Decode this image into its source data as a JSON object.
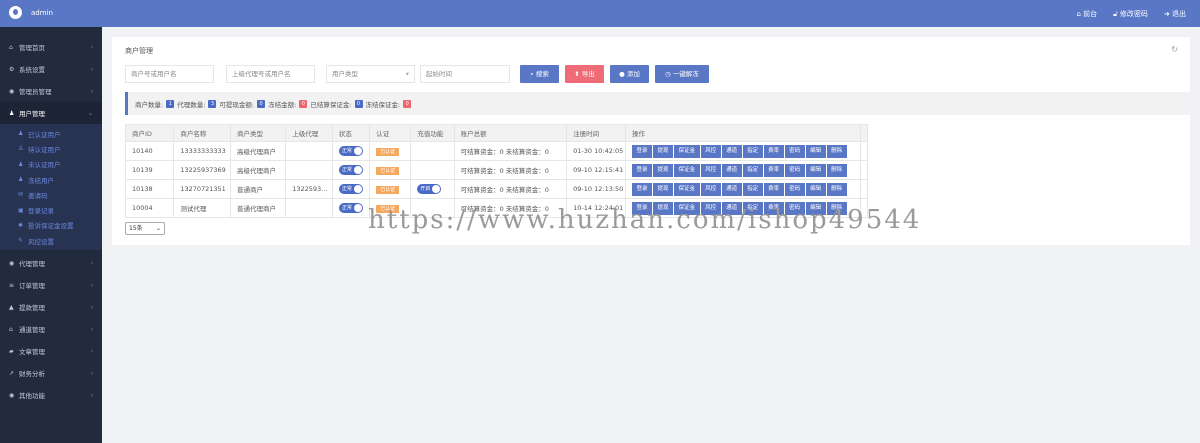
{
  "header": {
    "user": "admin",
    "links": [
      "前台",
      "修改密码",
      "退出"
    ]
  },
  "sidebar": {
    "items": [
      {
        "label": "管理首页",
        "icon": "home-icon"
      },
      {
        "label": "系统设置",
        "icon": "gears-icon"
      },
      {
        "label": "管理员管理",
        "icon": "user-circle-icon"
      },
      {
        "label": "用户管理",
        "icon": "users-icon",
        "open": true
      }
    ],
    "sub": [
      "已认证用户",
      "待认证用户",
      "未认证用户",
      "冻结用户",
      "邀请码",
      "登录记录",
      "投诉保证金设置",
      "风控设置"
    ],
    "items2": [
      {
        "label": "代理管理",
        "icon": "user-circle-icon"
      },
      {
        "label": "订单管理",
        "icon": "list-icon"
      },
      {
        "label": "提款管理",
        "icon": "bank-icon"
      },
      {
        "label": "通道管理",
        "icon": "institution-icon"
      },
      {
        "label": "文章管理",
        "icon": "book-icon"
      },
      {
        "label": "财务分析",
        "icon": "chart-icon"
      },
      {
        "label": "其他功能",
        "icon": "user-circle-icon"
      }
    ]
  },
  "page": {
    "title": "商户管理"
  },
  "filters": {
    "merchant_placeholder": "商户号或用户名",
    "agent_placeholder": "上级代理号或用户名",
    "type_select": "用户类型",
    "time_placeholder": "起始时间"
  },
  "buttons": {
    "search": "搜索",
    "export": "导出",
    "add": "添加",
    "unfreeze": "一键解冻"
  },
  "stats": [
    {
      "label": "商户数量:",
      "value": "1",
      "color": "#4a6bc5"
    },
    {
      "label": "代理数量:",
      "value": "3",
      "color": "#4a6bc5"
    },
    {
      "label": "可提现金额:",
      "value": "0",
      "color": "#4a6bc5"
    },
    {
      "label": "冻结金额:",
      "value": "0",
      "color": "#f0646e"
    },
    {
      "label": "已结算保证金:",
      "value": "0",
      "color": "#4a6bc5"
    },
    {
      "label": "冻结保证金:",
      "value": "0",
      "color": "#f0646e"
    }
  ],
  "table": {
    "headers": [
      "商户ID",
      "商户名称",
      "商户类型",
      "上级代理",
      "状态",
      "认证",
      "充值功能",
      "账户总额",
      "注册时间",
      "操作"
    ],
    "rows": [
      {
        "id": "10140",
        "name": "13333333333",
        "type": "高级代理商户",
        "agent": "",
        "status": "正常",
        "cert": "已认证",
        "recharge": "",
        "balance": "可结算资金：0 未结算资金：0",
        "time": "01-30 10:42:05"
      },
      {
        "id": "10139",
        "name": "13225937369",
        "type": "高级代理商户",
        "agent": "",
        "status": "正常",
        "cert": "已认证",
        "recharge": "",
        "balance": "可结算资金：0 未结算资金：0",
        "time": "09-10 12:15:41"
      },
      {
        "id": "10138",
        "name": "13270721351",
        "type": "普通商户",
        "agent": "1322593...",
        "status": "正常",
        "cert": "已认证",
        "recharge": "开启",
        "balance": "可结算资金：0 未结算资金：0",
        "time": "09-10 12:13:50"
      },
      {
        "id": "10004",
        "name": "测试代理",
        "type": "普通代理商户",
        "agent": "",
        "status": "正常",
        "cert": "已认证",
        "recharge": "",
        "balance": "可结算资金：0 未结算资金：0",
        "time": "10-14 12:24:01"
      }
    ],
    "ops": [
      "登录",
      "提现",
      "保证金",
      "风控",
      "通道",
      "指定",
      "费率",
      "密码",
      "编辑",
      "删除"
    ]
  },
  "page_size": "15条",
  "watermark": "https://www.huzhan.com/ishop49544"
}
